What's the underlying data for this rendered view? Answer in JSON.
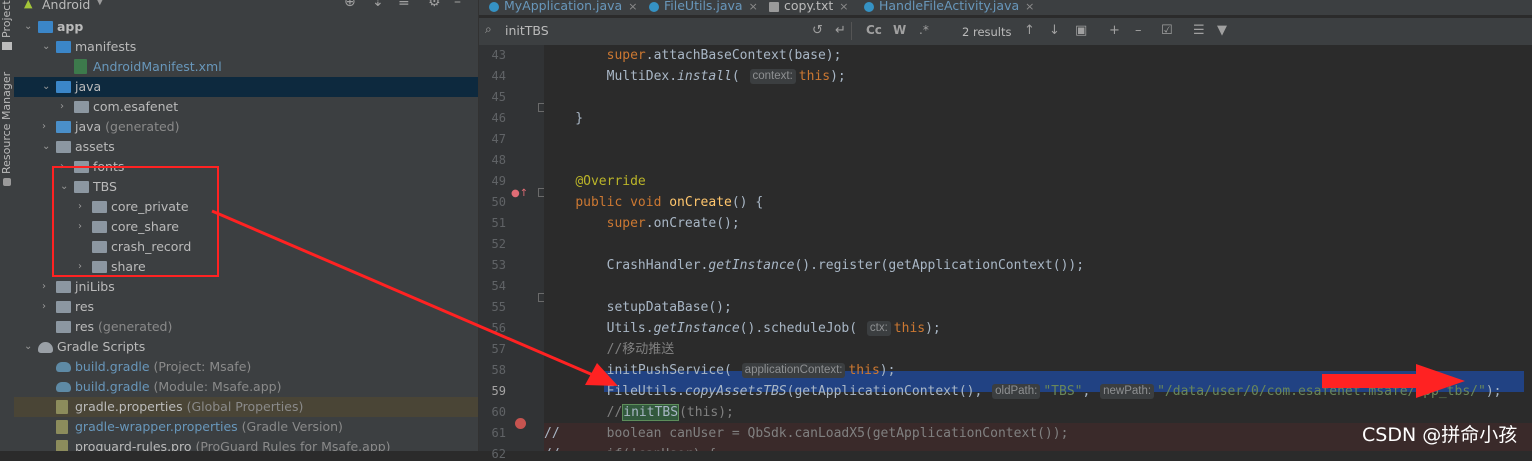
{
  "sidebar_stripe": {
    "project": "Project",
    "resource_manager": "Resource Manager"
  },
  "project_panel": {
    "view_selector": "Android"
  },
  "tree": [
    {
      "label": "app",
      "extra": "",
      "depth": 0,
      "chev": "open",
      "icon": "folder-blue",
      "bold": true
    },
    {
      "label": "manifests",
      "extra": "",
      "depth": 1,
      "chev": "open",
      "icon": "folder-blue"
    },
    {
      "label": "AndroidManifest.xml",
      "extra": "",
      "depth": 2,
      "chev": "",
      "icon": "xml",
      "link": true
    },
    {
      "label": "java",
      "extra": "",
      "depth": 1,
      "chev": "open",
      "icon": "folder-blue",
      "selected": true
    },
    {
      "label": "com.esafenet",
      "extra": "",
      "depth": 2,
      "chev": "closed",
      "icon": "folder"
    },
    {
      "label": "java",
      "extra": " (generated)",
      "depth": 1,
      "chev": "closed",
      "icon": "folder-src"
    },
    {
      "label": "assets",
      "extra": "",
      "depth": 1,
      "chev": "open",
      "icon": "folder"
    },
    {
      "label": "fonts",
      "extra": "",
      "depth": 2,
      "chev": "closed",
      "icon": "folder"
    },
    {
      "label": "TBS",
      "extra": "",
      "depth": 2,
      "chev": "open",
      "icon": "folder"
    },
    {
      "label": "core_private",
      "extra": "",
      "depth": 3,
      "chev": "closed",
      "icon": "folder"
    },
    {
      "label": "core_share",
      "extra": "",
      "depth": 3,
      "chev": "closed",
      "icon": "folder"
    },
    {
      "label": "crash_record",
      "extra": "",
      "depth": 3,
      "chev": "",
      "icon": "folder"
    },
    {
      "label": "share",
      "extra": "",
      "depth": 3,
      "chev": "closed",
      "icon": "folder"
    },
    {
      "label": "jniLibs",
      "extra": "",
      "depth": 1,
      "chev": "closed",
      "icon": "folder"
    },
    {
      "label": "res",
      "extra": "",
      "depth": 1,
      "chev": "closed",
      "icon": "folder"
    },
    {
      "label": "res",
      "extra": " (generated)",
      "depth": 1,
      "chev": "",
      "icon": "folder"
    },
    {
      "label": "Gradle Scripts",
      "extra": "",
      "depth": 0,
      "chev": "open",
      "icon": "gradle-grey"
    },
    {
      "label": "build.gradle",
      "extra": " (Project: Msafe)",
      "depth": 1,
      "chev": "",
      "icon": "gradle",
      "link": true
    },
    {
      "label": "build.gradle",
      "extra": " (Module: Msafe.app)",
      "depth": 1,
      "chev": "",
      "icon": "gradle",
      "link": true
    },
    {
      "label": "gradle.properties",
      "extra": " (Global Properties)",
      "depth": 1,
      "chev": "",
      "icon": "props",
      "highlight": true
    },
    {
      "label": "gradle-wrapper.properties",
      "extra": " (Gradle Version)",
      "depth": 1,
      "chev": "",
      "icon": "props",
      "link": true
    },
    {
      "label": "proguard-rules.pro",
      "extra": " (ProGuard Rules for Msafe.app)",
      "depth": 1,
      "chev": "",
      "icon": "props"
    }
  ],
  "tabs": [
    {
      "label": "MyApplication.java",
      "active": true
    },
    {
      "label": "FileUtils.java",
      "active": false
    },
    {
      "label": "copy.txt",
      "active": false
    },
    {
      "label": "HandleFileActivity.java",
      "active": false
    }
  ],
  "search": {
    "query": "initTBS",
    "results": "2 results",
    "case_label": "Cc",
    "word_label": "W",
    "regex_label": ".*"
  },
  "editor": {
    "current_line": "59",
    "lines": [
      {
        "n": "43",
        "segments": [
          {
            "t": "        "
          },
          {
            "t": "super",
            "c": "kw"
          },
          {
            "t": ".attachBaseContext(base);"
          }
        ]
      },
      {
        "n": "44",
        "segments": [
          {
            "t": "        MultiDex."
          },
          {
            "t": "install",
            "c": "ital"
          },
          {
            "t": "( "
          },
          {
            "t": "context:",
            "c": "hint"
          },
          {
            "t": "this",
            "c": "kw"
          },
          {
            "t": ");"
          }
        ]
      },
      {
        "n": "45",
        "segments": []
      },
      {
        "n": "46",
        "segments": [
          {
            "t": "    }"
          }
        ]
      },
      {
        "n": "47",
        "segments": []
      },
      {
        "n": "48",
        "segments": []
      },
      {
        "n": "49",
        "segments": [
          {
            "t": "    "
          },
          {
            "t": "@Override",
            "c": "ann"
          }
        ]
      },
      {
        "n": "50",
        "segments": [
          {
            "t": "    "
          },
          {
            "t": "public void ",
            "c": "kw"
          },
          {
            "t": "onCreate",
            "c": "fn"
          },
          {
            "t": "() {"
          }
        ]
      },
      {
        "n": "51",
        "segments": [
          {
            "t": "        "
          },
          {
            "t": "super",
            "c": "kw"
          },
          {
            "t": ".onCreate();"
          }
        ]
      },
      {
        "n": "52",
        "segments": []
      },
      {
        "n": "53",
        "segments": [
          {
            "t": "        CrashHandler."
          },
          {
            "t": "getInstance",
            "c": "ital"
          },
          {
            "t": "().register(getApplicationContext());"
          }
        ]
      },
      {
        "n": "54",
        "segments": []
      },
      {
        "n": "55",
        "segments": [
          {
            "t": "        setupDataBase();"
          }
        ]
      },
      {
        "n": "56",
        "segments": [
          {
            "t": "        Utils."
          },
          {
            "t": "getInstance",
            "c": "ital"
          },
          {
            "t": "().scheduleJob( "
          },
          {
            "t": "ctx:",
            "c": "hint"
          },
          {
            "t": "this",
            "c": "kw"
          },
          {
            "t": ");"
          }
        ]
      },
      {
        "n": "57",
        "segments": [
          {
            "t": "        "
          },
          {
            "t": "//移动推送",
            "c": "cmt"
          }
        ]
      },
      {
        "n": "58",
        "segments": [
          {
            "t": "        initPushService( "
          },
          {
            "t": "applicationContext:",
            "c": "hint"
          },
          {
            "t": "this",
            "c": "kw"
          },
          {
            "t": ");"
          }
        ]
      },
      {
        "n": "59",
        "segments": [
          {
            "t": "        FileUtils."
          },
          {
            "t": "copyAssetsTBS",
            "c": "ital"
          },
          {
            "t": "(getApplicationContext(), "
          },
          {
            "t": "oldPath:",
            "c": "hint"
          },
          {
            "t": "\"TBS\"",
            "c": "str"
          },
          {
            "t": ", "
          },
          {
            "t": "newPath:",
            "c": "hint"
          },
          {
            "t": "\"/data/user/0/com.esafenet.msafe/app_tbs/\"",
            "c": "str"
          },
          {
            "t": ");"
          }
        ]
      },
      {
        "n": "60",
        "segments": [
          {
            "t": "        "
          },
          {
            "t": "//",
            "c": "cmt"
          },
          {
            "t": "initTBS",
            "c": "srch"
          },
          {
            "t": "(this);",
            "c": "cmt"
          }
        ]
      },
      {
        "n": "61",
        "segments": [
          {
            "t": "//      "
          },
          {
            "t": "boolean canUser = QbSdk.canLoadX5(getApplicationContext());",
            "c": "cmt"
          }
        ]
      },
      {
        "n": "62",
        "segments": [
          {
            "t": "//      "
          },
          {
            "t": "if(!canUser) {",
            "c": "cmt"
          }
        ]
      }
    ]
  },
  "watermark": "CSDN @拼命小孩",
  "colors": {
    "accent_blue": "#4a88c7",
    "annotation_red": "#ff2222",
    "selection": "#214283"
  }
}
